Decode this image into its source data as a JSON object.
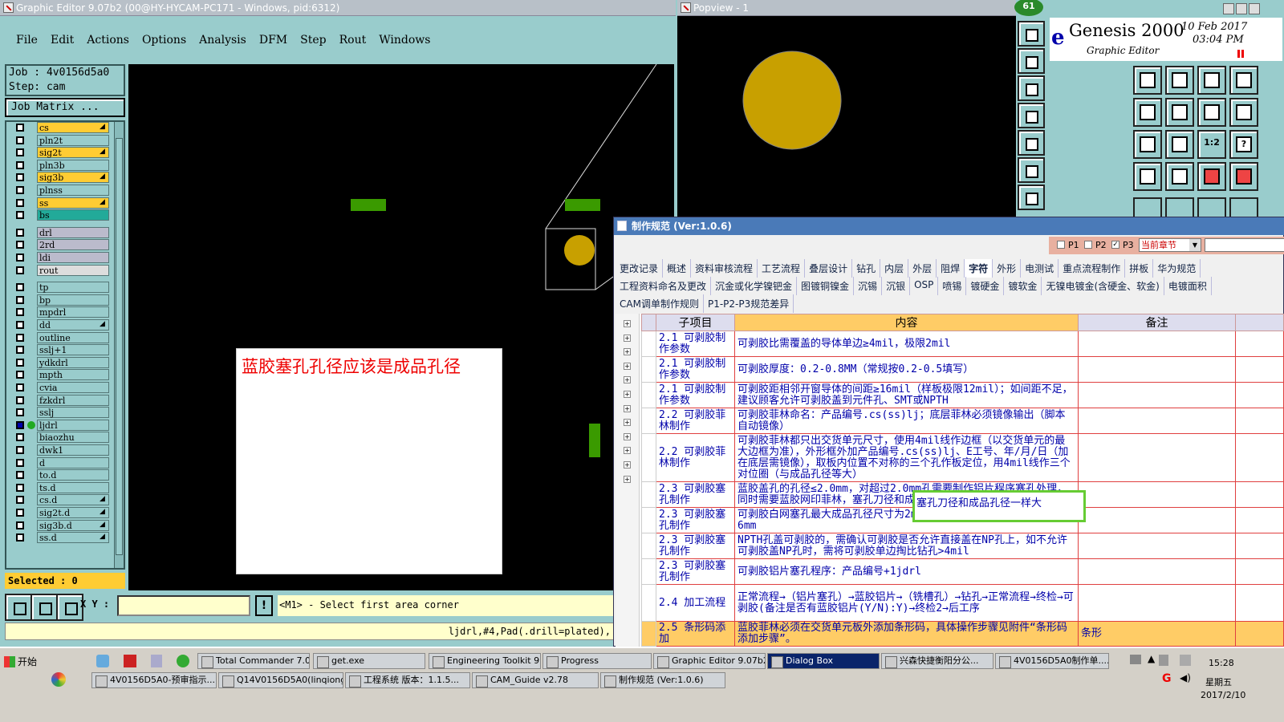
{
  "main_window": {
    "title": "Graphic Editor 9.07b2 (00@HY-HYCAM-PC171 - Windows, pid:6312)",
    "menus": [
      "File",
      "Edit",
      "Actions",
      "Options",
      "Analysis",
      "DFM",
      "Step",
      "Rout",
      "Windows"
    ]
  },
  "job": {
    "job": "Job : 4v0156d5a0",
    "step": "Step: cam",
    "matrix": "Job Matrix ..."
  },
  "layers": [
    {
      "name": "cs",
      "style": "yel",
      "arrow": true
    },
    {
      "name": "pln2t",
      "style": ""
    },
    {
      "name": "sig2t",
      "style": "yel",
      "arrow": true
    },
    {
      "name": "pln3b",
      "style": ""
    },
    {
      "name": "sig3b",
      "style": "yel",
      "arrow": true
    },
    {
      "name": "plnss",
      "style": ""
    },
    {
      "name": "ss",
      "style": "yel",
      "arrow": true
    },
    {
      "name": "bs",
      "style": "gr"
    },
    {
      "name": "drl",
      "style": "gry"
    },
    {
      "name": "2rd",
      "style": "gry"
    },
    {
      "name": "ldi",
      "style": "gry"
    },
    {
      "name": "rout",
      "style": "wht"
    },
    {
      "name": "tp",
      "style": ""
    },
    {
      "name": "bp",
      "style": ""
    },
    {
      "name": "mpdrl",
      "style": ""
    },
    {
      "name": "dd",
      "style": "",
      "arrow": true
    },
    {
      "name": "outline",
      "style": ""
    },
    {
      "name": "sslj+1",
      "style": ""
    },
    {
      "name": "ydkdrl",
      "style": ""
    },
    {
      "name": "mpth",
      "style": ""
    },
    {
      "name": "cvia",
      "style": ""
    },
    {
      "name": "fzkdrl",
      "style": ""
    },
    {
      "name": "sslj",
      "style": ""
    },
    {
      "name": "ljdrl",
      "style": "",
      "active": true
    },
    {
      "name": "biaozhu",
      "style": ""
    },
    {
      "name": "dwk1",
      "style": ""
    },
    {
      "name": "d",
      "style": ""
    },
    {
      "name": "to.d",
      "style": ""
    },
    {
      "name": "ts.d",
      "style": ""
    },
    {
      "name": "cs.d",
      "style": "",
      "arrow": true
    },
    {
      "name": "sig2t.d",
      "style": "",
      "arrow": true
    },
    {
      "name": "sig3b.d",
      "style": "",
      "arrow": true
    },
    {
      "name": "ss.d",
      "style": "",
      "arrow": true
    }
  ],
  "selected": "Selected : 0",
  "xy_label": "X Y :",
  "prompt": "<M1> - Select first area corner",
  "status_line": "ljdrl,#4,Pad(.drill=plated),",
  "annotation": "蓝胶塞孔孔径应该是成品孔径",
  "popview": {
    "title": "Popview - 1"
  },
  "badge": "61",
  "genesis": {
    "logo": "Genesis 2000",
    "subtitle": "Graphic Editor",
    "date": "10 Feb 2017",
    "time": "03:04 PM",
    "logo_mark": "e"
  },
  "tool_icons": [
    "view-icon",
    "zoom-in-icon",
    "home-icon",
    "grid-icon",
    "snap-icon",
    "pan-icon",
    "ratio-icon",
    "split-icon",
    "fit-icon",
    "center-icon",
    "one-to-one-icon",
    "help-icon",
    "measure-icon",
    "target-icon",
    "drill-icon",
    "drill-map-icon"
  ],
  "tool_labels": {
    "ratio": "1:2",
    "help": "?"
  },
  "dialog": {
    "title": "制作规范 (Ver:1.0.6)",
    "filters": {
      "p1": "P1",
      "p2": "P2",
      "p3": "P3",
      "scope": "当前章节"
    },
    "tabs1": [
      "更改记录",
      "概述",
      "资料审核流程",
      "工艺流程",
      "叠层设计",
      "钻孔",
      "内层",
      "外层",
      "阻焊",
      "字符",
      "外形",
      "电测试",
      "重点流程制作",
      "拼板",
      "华为规范"
    ],
    "tabs2": [
      "工程资料命名及更改",
      "沉金或化学镍钯金",
      "图镀铜镍金",
      "沉锡",
      "沉银",
      "OSP",
      "喷锡",
      "镀硬金",
      "镀软金",
      "无镍电镀金(含硬金、软金)",
      "电镀面积"
    ],
    "tabs3": [
      "CAM调单制作规则",
      "P1-P2-P3规范差异"
    ],
    "active_tab": "字符",
    "headers": {
      "sub": "子项目",
      "content": "内容",
      "note": "备注"
    },
    "rows": [
      {
        "sub": "2.1 可剥胶制作参数",
        "content": "可剥胶比需覆盖的导体单边≥4mil，极限2mil"
      },
      {
        "sub": "2.1 可剥胶制作参数",
        "content": "可剥胶厚度：0.2-0.8MM（常规按0.2-0.5填写）"
      },
      {
        "sub": "2.1 可剥胶制作参数",
        "content": "可剥胶距相邻开窗导体的间距≥16mil（样板极限12mil）；如间距不足，建议顾客允许可剥胶盖到元件孔、SMT或NPTH"
      },
      {
        "sub": "2.2 可剥胶菲林制作",
        "content": "可剥胶菲林命名：产品编号.cs(ss)lj；底层菲林必须镜像输出（脚本自动镜像）"
      },
      {
        "sub": "2.2 可剥胶菲林制作",
        "content": "可剥胶菲林都只出交货单元尺寸，使用4mil线作边框（以交货单元的最大边框为准），外形框外加产品编号.cs(ss)lj、E工号、年/月/日（加在底层需镜像），取板内位置不对称的三个孔作板定位，用4mil线作三个对位圈（与成品孔径等大）"
      },
      {
        "sub": "2.3 可剥胶塞孔制作",
        "content": "蓝胶盖孔的孔径≤2.0mm，对超过2.0mm孔需要制作铝片程序塞孔处理，同时需要蓝胶网印菲林，塞孔刀径和成品孔径一样大"
      },
      {
        "sub": "2.3 可剥胶塞孔制作",
        "content": "可剥胶白网塞孔最大成品孔径尺寸为2mm；可剥胶铝片塞孔为5mm，极限6mm"
      },
      {
        "sub": "2.3 可剥胶塞孔制作",
        "content": "NPTH孔盖可剥胶的，需确认可剥胶是否允许直接盖在NP孔上，如不允许可剥胶盖NP孔时，需将可剥胶单边掏比钻孔>4mil"
      },
      {
        "sub": "2.3 可剥胶塞孔制作",
        "content": "可剥胶铝片塞孔程序：产品编号+1jdrl"
      },
      {
        "sub": "2.4 加工流程",
        "content": "正常流程→（铝片塞孔）→蓝胶铝片→（铣槽孔）→钻孔→正常流程→终检→可剥胶(备注是否有蓝胶铝片(Y/N):Y)→终检2→后工序"
      },
      {
        "sub": "2.5 条形码添加",
        "content": "蓝胶菲林必须在交货单元板外添加条形码，具体操作步骤见附件“条形码添加步骤”。",
        "note": "条形"
      }
    ],
    "highlight_note": "塞孔刀径和成品孔径一样大"
  },
  "taskbar": {
    "start": "开始",
    "row1": [
      "Total Commander 7.0...",
      "get.exe",
      "Engineering Toolkit 9....",
      "Progress",
      "Graphic Editor 9.07b2...",
      "Dialog Box",
      "兴森快捷衡阳分公...",
      "4V0156D5A0制作单...."
    ],
    "row2": [
      "4V0156D5A0-预审指示....",
      "Q14V0156D5A0(linqiong)...",
      "工程系统  版本：1.1.5...",
      "CAM_Guide v2.78",
      "制作规范 (Ver:1.0.6)"
    ],
    "clock": {
      "time": "15:28",
      "day": "星期五",
      "date": "2017/2/10"
    }
  },
  "colors": {
    "board": "#000000",
    "pad": "#c8a000",
    "trace": "#3a9a00",
    "panel": "#99cccc",
    "highlight": "#66cc33"
  }
}
